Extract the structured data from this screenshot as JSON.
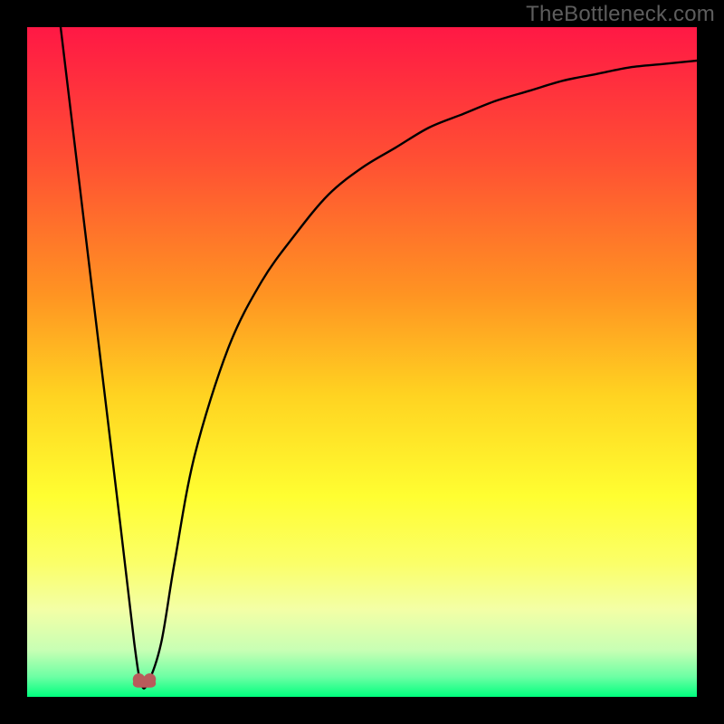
{
  "watermark": "TheBottleneck.com",
  "chart_data": {
    "type": "line",
    "title": "",
    "xlabel": "",
    "ylabel": "",
    "xlim": [
      0,
      100
    ],
    "ylim": [
      0,
      100
    ],
    "series": [
      {
        "name": "bottleneck-curve",
        "x": [
          5,
          8,
          11,
          14,
          16,
          17,
          18,
          20,
          22,
          25,
          30,
          35,
          40,
          45,
          50,
          55,
          60,
          65,
          70,
          75,
          80,
          85,
          90,
          95,
          100
        ],
        "values": [
          100,
          75,
          50,
          25,
          8,
          2,
          2,
          8,
          20,
          36,
          52,
          62,
          69,
          75,
          79,
          82,
          85,
          87,
          89,
          90.5,
          92,
          93,
          94,
          94.5,
          95
        ]
      }
    ],
    "markers": [
      {
        "name": "valley-marker",
        "x": 17.5,
        "y": 2,
        "color": "#b85b5b"
      }
    ],
    "background_gradient": {
      "stops": [
        {
          "offset": 0.0,
          "color": "#ff1845"
        },
        {
          "offset": 0.2,
          "color": "#ff5033"
        },
        {
          "offset": 0.4,
          "color": "#ff9422"
        },
        {
          "offset": 0.55,
          "color": "#ffd321"
        },
        {
          "offset": 0.7,
          "color": "#fffe31"
        },
        {
          "offset": 0.8,
          "color": "#fbff68"
        },
        {
          "offset": 0.87,
          "color": "#f3ffa6"
        },
        {
          "offset": 0.93,
          "color": "#c8ffb4"
        },
        {
          "offset": 0.97,
          "color": "#6dffa4"
        },
        {
          "offset": 1.0,
          "color": "#00ff7e"
        }
      ]
    }
  }
}
